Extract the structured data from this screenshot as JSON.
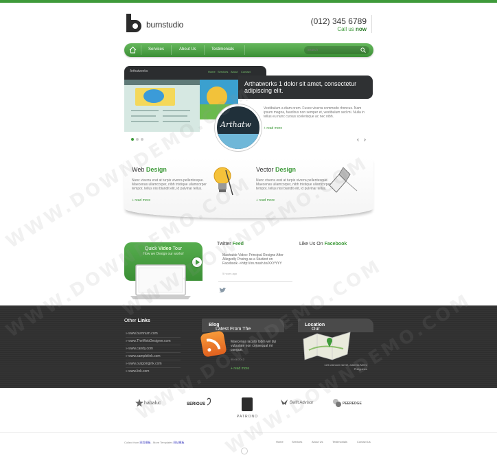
{
  "brand": {
    "name": "burnstudio",
    "accent": "#3e9a3a",
    "dark": "#333333"
  },
  "header": {
    "phone": "(012) 345 6789",
    "call_prefix": "Call us",
    "call_emph": "now"
  },
  "nav": {
    "items": [
      "Services",
      "About Us",
      "Testimonials"
    ],
    "search_placeholder": "search"
  },
  "slider": {
    "frame_title": "Arthatworks",
    "frame_menu": [
      "Home",
      "Services",
      "About",
      "Contact"
    ],
    "caption": "Arthatworks 1 dolor sit amet, consectetur adipiscing elit.",
    "bubble_text": "Arthatw",
    "text": "Vestibulum a diam orem. Fusce viverra commodo rhoncus. Nam ipsum magna, faucibus non semper et, vestibulum sed mi. Nulla in tellus eu nunc cursus scelerisque ac nec nibh.",
    "more": "read more"
  },
  "features": [
    {
      "title_a": "Web",
      "title_b": "Design",
      "text": "Nunc viverra erat at turpis viverra pellentesque. Maecenas ullamcorper, nibh tristique ullamcorper tempor, tellus nisi blandit elit, id pulvinar tellus.",
      "more": "read more"
    },
    {
      "title_a": "Vector",
      "title_b": "Design",
      "text": "Nunc viverra erat at turpis viverra pellentesque. Maecenas ullamcorper, nibh tristique ullamcorper tempor, tellus nisi blandit elit, id pulvinar tellus.",
      "more": "read more"
    }
  ],
  "video": {
    "title_a": "Quick",
    "title_b": "Video",
    "title_c": "Tour",
    "subtitle": "How we Design our works!"
  },
  "twitter": {
    "title_a": "Twitter",
    "title_b": "Feed",
    "text": "Mashable Video: Principal Resigns After Allegedly Posing as a Student on Facebook ->http://on.mash.to/XXYYYY",
    "time": "5 hours ago"
  },
  "facebook": {
    "title_a": "Like Us On",
    "title_b": "Facebook"
  },
  "footer_dark": {
    "links_title_a": "Other",
    "links_title_b": "Links",
    "links": [
      "www.burnnum.com",
      "www.TheWebDesigner.com",
      "www.candy.com",
      "www.samplelink.com",
      "www.outgoingink.com",
      "www.link.com"
    ],
    "blog_title_a": "Latest From The",
    "blog_title_b": "Blog",
    "blog_text": "Maecenas iaculis lobm vel dui vulputate non consequat mi congue.",
    "blog_date": "05.08.2012",
    "blog_more": "read more",
    "location_title_a": "Our",
    "location_title_b": "Location",
    "address": "123 unknown street, address Metro Philippines"
  },
  "clients": [
    "habaluc",
    "SERIOUS",
    "PATRONO",
    "Swift Advisor",
    "PEEREDGE"
  ],
  "footer": {
    "copy_prefix": "Collect from",
    "copy_link1": "网页模板",
    "copy_mid": " - More Templates",
    "copy_link2": "网站模板",
    "nav": [
      "Home",
      "Services",
      "About Us",
      "Testimonials",
      "Contact Us"
    ]
  },
  "watermark": "WWW.DOWNDEMO.COM"
}
